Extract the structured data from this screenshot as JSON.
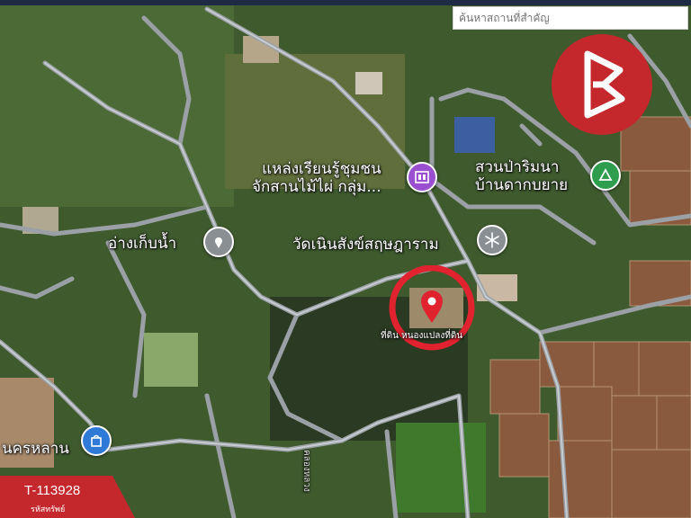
{
  "search": {
    "placeholder": "ค้นหาสถานที่สำคัญ"
  },
  "labels": {
    "community_center": "แหล่งเรียนรู้ชุมชน\nจักสานไม้ไผ่ กลุ่ม...",
    "garden": "สวนป่าริมนา\nบ้านดากบยาย",
    "water_works": "อ่างเก็บน้ำ",
    "temple": "วัดเนินสังข์สฤษฎาราม",
    "land_plot": "ที่ดิน หนองแปลงที่ดิน",
    "town": "นครหลาน",
    "road": "คลองหลวง"
  },
  "listing": {
    "code": "T-113928",
    "caption": "รหัสทรัพย์"
  },
  "colors": {
    "brand_red": "#c4282c",
    "poi_purple": "#9a4fd0",
    "poi_green": "#2e9e4e",
    "poi_gray": "#8a8f94",
    "poi_blue": "#2f7ad6",
    "pin_red": "#e0232e"
  },
  "icons": {
    "logo": "brand-b-logo",
    "community": "museum-icon",
    "garden": "park-triangle-icon",
    "water": "map-pin-icon",
    "temple": "snowflake-temple-icon",
    "town": "shopping-bag-icon",
    "pin": "location-pin-icon"
  }
}
